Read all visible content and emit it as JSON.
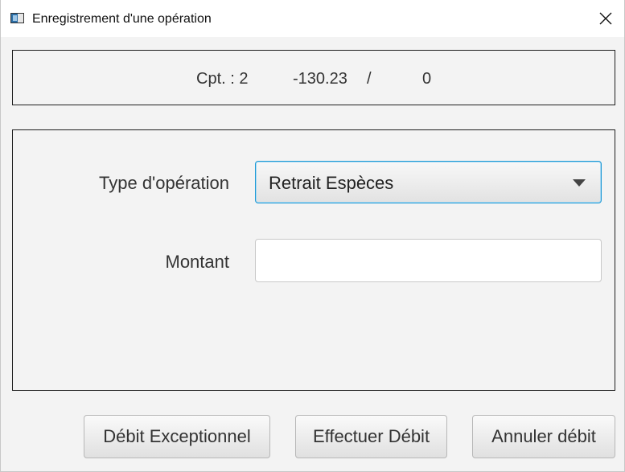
{
  "window": {
    "title": "Enregistrement d'une opération",
    "app_icon": "window-app-icon",
    "close_icon": "close-icon"
  },
  "account_info": {
    "account": "Cpt. : 2",
    "balance": "-130.23",
    "separator": "/",
    "overdraft": "0"
  },
  "form": {
    "operation_type_label": "Type d'opération",
    "operation_type_value": "Retrait Espèces",
    "amount_label": "Montant",
    "amount_value": "",
    "amount_placeholder": ""
  },
  "buttons": {
    "exceptional_debit": "Débit Exceptionnel",
    "perform_debit": "Effectuer Débit",
    "cancel_debit": "Annuler débit"
  }
}
